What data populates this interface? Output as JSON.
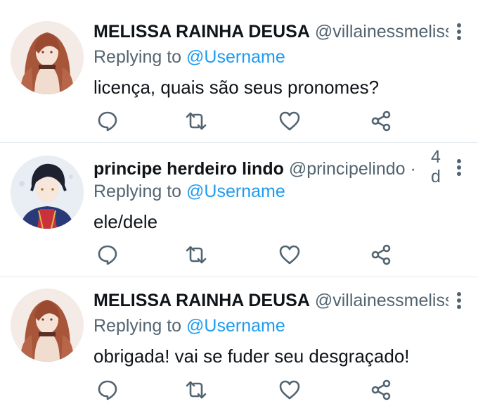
{
  "tweets": [
    {
      "name": "MELISSA RAINHA DEUSA",
      "handle": "@villainessmelissa",
      "replying_prefix": "Replying to",
      "replying_user": "@Username",
      "text": "licença, quais são seus pronomes?"
    },
    {
      "name": "principe herdeiro lindo",
      "handle": "@principelindo",
      "dot": "·",
      "time_line1": "4",
      "time_line2": "d",
      "replying_prefix": "Replying to",
      "replying_user": "@Username",
      "text": "ele/dele"
    },
    {
      "name": "MELISSA RAINHA DEUSA",
      "handle": "@villainessmelissa",
      "replying_prefix": "Replying to",
      "replying_user": "@Username",
      "text": "obrigada! vai se fuder seu desgraçado!"
    }
  ],
  "icons": [
    "reply-icon",
    "retweet-icon",
    "like-icon",
    "share-icon",
    "more-options-icon"
  ],
  "colors": {
    "text": "#0f1419",
    "secondary": "#536471",
    "link": "#1d9bf0",
    "divider": "#e6ecf0"
  }
}
